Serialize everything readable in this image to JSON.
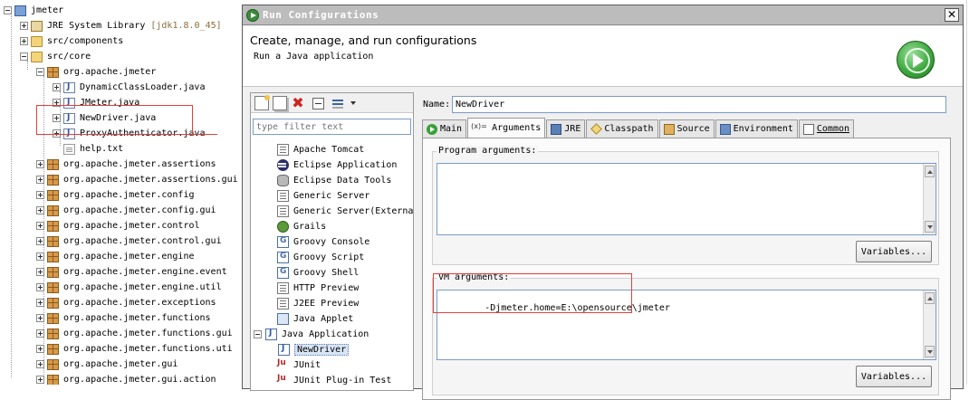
{
  "explorer": {
    "project": "jmeter",
    "jre_library": "JRE System Library",
    "jre_version": "[jdk1.8.0_45]",
    "src_components": "src/components",
    "src_core": "src/core",
    "pkg_root": "org.apache.jmeter",
    "files": [
      "DynamicClassLoader.java",
      "JMeter.java",
      "NewDriver.java",
      "ProxyAuthenticator.java",
      "help.txt"
    ],
    "packages": [
      "org.apache.jmeter.assertions",
      "org.apache.jmeter.assertions.gui",
      "org.apache.jmeter.config",
      "org.apache.jmeter.config.gui",
      "org.apache.jmeter.control",
      "org.apache.jmeter.control.gui",
      "org.apache.jmeter.engine",
      "org.apache.jmeter.engine.event",
      "org.apache.jmeter.engine.util",
      "org.apache.jmeter.exceptions",
      "org.apache.jmeter.functions",
      "org.apache.jmeter.functions.gui",
      "org.apache.jmeter.functions.uti",
      "org.apache.jmeter.gui",
      "org.apache.jmeter.gui.action"
    ]
  },
  "dialog": {
    "title": "Run Configurations",
    "close": "✕",
    "header_title": "Create, manage, and run configurations",
    "header_subtitle": "Run a Java application",
    "filter_placeholder": "type filter text",
    "config_types": [
      "Apache Tomcat",
      "Eclipse Application",
      "Eclipse Data Tools",
      "Generic Server",
      "Generic Server(Externa",
      "Grails",
      "Groovy Console",
      "Groovy Script",
      "Groovy Shell",
      "HTTP Preview",
      "J2EE Preview",
      "Java Applet",
      "Java Application",
      "NewDriver",
      "JUnit",
      "JUnit Plug-in Test"
    ],
    "name_label": "Name:",
    "name_value": "NewDriver",
    "tabs": [
      "Main",
      "Arguments",
      "JRE",
      "Classpath",
      "Source",
      "Environment",
      "Common"
    ],
    "program_args_label": "Program arguments:",
    "program_args_value": "",
    "vm_args_label": "VM arguments:",
    "vm_args_value": "-Djmeter.home=E:\\opensource\\jmeter",
    "variables_button": "Variables..."
  }
}
